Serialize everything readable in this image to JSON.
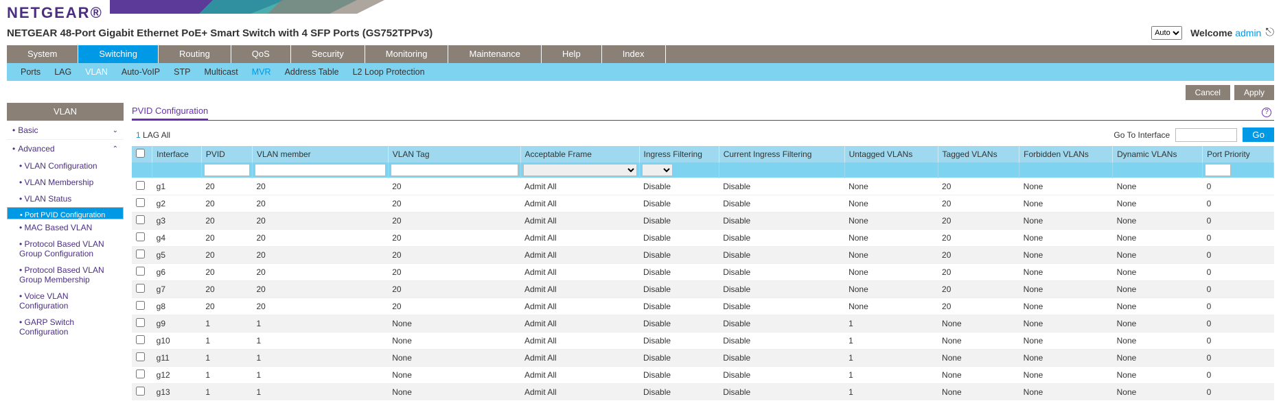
{
  "brand": "NETGEAR",
  "product": "NETGEAR 48-Port Gigabit Ethernet PoE+ Smart Switch with 4 SFP Ports (GS752TPPv3)",
  "lang_value": "Auto",
  "welcome_label": "Welcome",
  "welcome_user": "admin",
  "nav": [
    "System",
    "Switching",
    "Routing",
    "QoS",
    "Security",
    "Monitoring",
    "Maintenance",
    "Help",
    "Index"
  ],
  "nav_active": 1,
  "subnav": [
    "Ports",
    "LAG",
    "VLAN",
    "Auto-VoIP",
    "STP",
    "Multicast",
    "MVR",
    "Address Table",
    "L2 Loop Protection"
  ],
  "actions": {
    "cancel": "Cancel",
    "apply": "Apply"
  },
  "sidebar": {
    "title": "VLAN",
    "basic": "Basic",
    "advanced": "Advanced",
    "items": [
      "VLAN Configuration",
      "VLAN Membership",
      "VLAN Status",
      "Port PVID Configuration",
      "MAC Based VLAN",
      "Protocol Based VLAN Group Configuration",
      "Protocol Based VLAN Group Membership",
      "Voice VLAN Configuration",
      "GARP Switch Configuration"
    ],
    "selected": 3
  },
  "section_title": "PVID Configuration",
  "filter": {
    "num": "1",
    "lag": "LAG",
    "all": "All",
    "goto_label": "Go To Interface",
    "go": "Go"
  },
  "columns": [
    "Interface",
    "PVID",
    "VLAN member",
    "VLAN Tag",
    "Acceptable Frame",
    "Ingress Filtering",
    "Current Ingress Filtering",
    "Untagged VLANs",
    "Tagged VLANs",
    "Forbidden VLANs",
    "Dynamic VLANs",
    "Port Priority"
  ],
  "rows": [
    {
      "if": "g1",
      "pvid": "20",
      "mem": "20",
      "tag": "20",
      "accept": "Admit All",
      "ingress": "Disable",
      "curring": "Disable",
      "untag": "None",
      "tagged": "20",
      "forbid": "None",
      "dyn": "None",
      "prio": "0"
    },
    {
      "if": "g2",
      "pvid": "20",
      "mem": "20",
      "tag": "20",
      "accept": "Admit All",
      "ingress": "Disable",
      "curring": "Disable",
      "untag": "None",
      "tagged": "20",
      "forbid": "None",
      "dyn": "None",
      "prio": "0"
    },
    {
      "if": "g3",
      "pvid": "20",
      "mem": "20",
      "tag": "20",
      "accept": "Admit All",
      "ingress": "Disable",
      "curring": "Disable",
      "untag": "None",
      "tagged": "20",
      "forbid": "None",
      "dyn": "None",
      "prio": "0"
    },
    {
      "if": "g4",
      "pvid": "20",
      "mem": "20",
      "tag": "20",
      "accept": "Admit All",
      "ingress": "Disable",
      "curring": "Disable",
      "untag": "None",
      "tagged": "20",
      "forbid": "None",
      "dyn": "None",
      "prio": "0"
    },
    {
      "if": "g5",
      "pvid": "20",
      "mem": "20",
      "tag": "20",
      "accept": "Admit All",
      "ingress": "Disable",
      "curring": "Disable",
      "untag": "None",
      "tagged": "20",
      "forbid": "None",
      "dyn": "None",
      "prio": "0"
    },
    {
      "if": "g6",
      "pvid": "20",
      "mem": "20",
      "tag": "20",
      "accept": "Admit All",
      "ingress": "Disable",
      "curring": "Disable",
      "untag": "None",
      "tagged": "20",
      "forbid": "None",
      "dyn": "None",
      "prio": "0"
    },
    {
      "if": "g7",
      "pvid": "20",
      "mem": "20",
      "tag": "20",
      "accept": "Admit All",
      "ingress": "Disable",
      "curring": "Disable",
      "untag": "None",
      "tagged": "20",
      "forbid": "None",
      "dyn": "None",
      "prio": "0"
    },
    {
      "if": "g8",
      "pvid": "20",
      "mem": "20",
      "tag": "20",
      "accept": "Admit All",
      "ingress": "Disable",
      "curring": "Disable",
      "untag": "None",
      "tagged": "20",
      "forbid": "None",
      "dyn": "None",
      "prio": "0"
    },
    {
      "if": "g9",
      "pvid": "1",
      "mem": "1",
      "tag": "None",
      "accept": "Admit All",
      "ingress": "Disable",
      "curring": "Disable",
      "untag": "1",
      "tagged": "None",
      "forbid": "None",
      "dyn": "None",
      "prio": "0"
    },
    {
      "if": "g10",
      "pvid": "1",
      "mem": "1",
      "tag": "None",
      "accept": "Admit All",
      "ingress": "Disable",
      "curring": "Disable",
      "untag": "1",
      "tagged": "None",
      "forbid": "None",
      "dyn": "None",
      "prio": "0"
    },
    {
      "if": "g11",
      "pvid": "1",
      "mem": "1",
      "tag": "None",
      "accept": "Admit All",
      "ingress": "Disable",
      "curring": "Disable",
      "untag": "1",
      "tagged": "None",
      "forbid": "None",
      "dyn": "None",
      "prio": "0"
    },
    {
      "if": "g12",
      "pvid": "1",
      "mem": "1",
      "tag": "None",
      "accept": "Admit All",
      "ingress": "Disable",
      "curring": "Disable",
      "untag": "1",
      "tagged": "None",
      "forbid": "None",
      "dyn": "None",
      "prio": "0"
    },
    {
      "if": "g13",
      "pvid": "1",
      "mem": "1",
      "tag": "None",
      "accept": "Admit All",
      "ingress": "Disable",
      "curring": "Disable",
      "untag": "1",
      "tagged": "None",
      "forbid": "None",
      "dyn": "None",
      "prio": "0"
    }
  ],
  "shaded_rows": [
    2,
    4,
    6,
    8,
    10,
    12
  ]
}
